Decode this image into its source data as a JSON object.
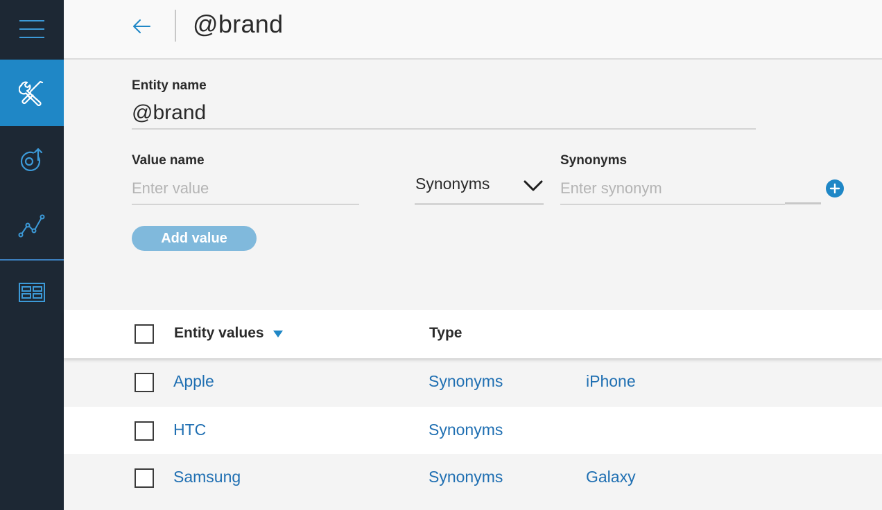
{
  "nav": {
    "items": [
      {
        "name": "menu",
        "icon": "hamburger-menu-icon"
      },
      {
        "name": "build",
        "icon": "tools-icon",
        "active": true
      },
      {
        "name": "deploy",
        "icon": "deploy-icon"
      },
      {
        "name": "improve",
        "icon": "line-chart-icon"
      },
      {
        "name": "tables",
        "icon": "table-grid-icon"
      }
    ],
    "active_color": "#1f87c6",
    "background_color": "#1d2834"
  },
  "header": {
    "title": "@brand"
  },
  "form": {
    "entity_name_label": "Entity name",
    "entity_name_value": "@brand",
    "value_name_label": "Value name",
    "value_placeholder": "Enter value",
    "type_select_value": "Synonyms",
    "synonyms_label": "Synonyms",
    "synonym_placeholder": "Enter synonym",
    "add_value_label": "Add value"
  },
  "table": {
    "columns": [
      "Entity values",
      "Type"
    ],
    "rows": [
      {
        "value": "Apple",
        "type": "Synonyms",
        "synonyms": "iPhone"
      },
      {
        "value": "HTC",
        "type": "Synonyms",
        "synonyms": ""
      },
      {
        "value": "Samsung",
        "type": "Synonyms",
        "synonyms": "Galaxy"
      }
    ]
  },
  "colors": {
    "link": "#1f6fb2",
    "accent": "#1f87c6",
    "disabled_button": "#80b9dc"
  }
}
